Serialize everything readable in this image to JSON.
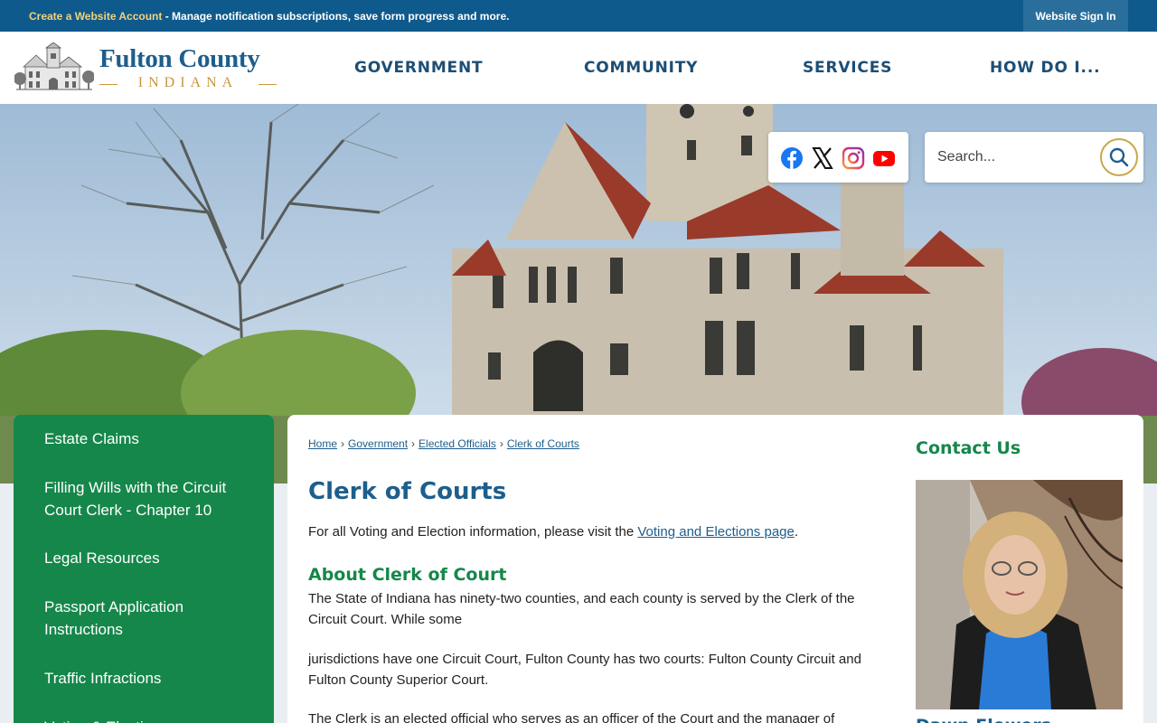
{
  "topbar": {
    "link": "Create a Website Account",
    "text": " - Manage notification subscriptions, save form progress and more.",
    "signin": "Website Sign In"
  },
  "logo": {
    "county": "Fulton County",
    "state": "INDIANA"
  },
  "nav": [
    "GOVERNMENT",
    "COMMUNITY",
    "SERVICES",
    "HOW DO I..."
  ],
  "search": {
    "placeholder": "Search..."
  },
  "social_icons": [
    "facebook-icon",
    "x-icon",
    "instagram-icon",
    "youtube-icon"
  ],
  "sidebar": {
    "items": [
      "Estate Claims",
      "Filling Wills with the Circuit Court Clerk - Chapter 10",
      "Legal Resources",
      "Passport Application Instructions",
      "Traffic Infractions",
      "Voting & Elections"
    ]
  },
  "breadcrumbs": [
    "Home",
    "Government",
    "Elected Officials",
    "Clerk of Courts"
  ],
  "page": {
    "title": "Clerk of Courts",
    "intro_before": "For all Voting and Election information, please visit the ",
    "intro_link": "Voting and Elections page",
    "intro_after": ".",
    "section_heading": "About Clerk of Court",
    "paragraphs": [
      "The State of Indiana has ninety-two counties, and each county is served by the Clerk of the Circuit Court. While some",
      "jurisdictions have one Circuit Court, Fulton County has two courts: Fulton County Circuit and Fulton County Superior Court.",
      "The Clerk is an elected official who serves as an officer of the Court and the manager of"
    ]
  },
  "contact": {
    "heading": "Contact Us",
    "name": "Dawn Flowers"
  },
  "colors": {
    "topbar": "#0f5a8c",
    "nav_text": "#1d4e74",
    "sidebar": "#15874a",
    "heading_blue": "#1d5e8c",
    "heading_green": "#15874a",
    "gold": "#c9963a"
  }
}
